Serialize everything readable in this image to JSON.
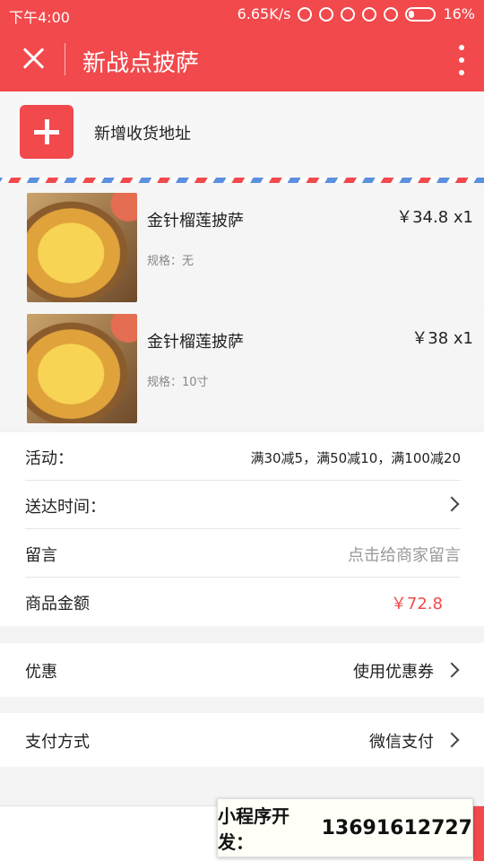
{
  "status_bar": {
    "time": "下午4:00",
    "speed": "6.65K/s",
    "battery": "16%"
  },
  "header": {
    "title": "新战点披萨"
  },
  "address": {
    "add_label": "新增收货地址"
  },
  "items": [
    {
      "name": "金针榴莲披萨",
      "spec": "规格：无",
      "price": "￥34.8 x1"
    },
    {
      "name": "金针榴莲披萨",
      "spec": "规格：10寸",
      "price": "￥38 x1"
    }
  ],
  "info": {
    "activity_label": "活动：",
    "activity_value": "满30减5，满50减10，满100减20",
    "delivery_label": "送达时间：",
    "message_label": "留言",
    "message_placeholder": "点击给商家留言",
    "amount_label": "商品金额",
    "amount_value": "￥72.8"
  },
  "discount": {
    "label": "优惠",
    "value": "使用优惠券"
  },
  "payment": {
    "label": "支付方式",
    "value": "微信支付"
  },
  "promo": {
    "text": "小程序开发：",
    "phone": "13691612727"
  },
  "colors": {
    "accent": "#f2494c"
  }
}
